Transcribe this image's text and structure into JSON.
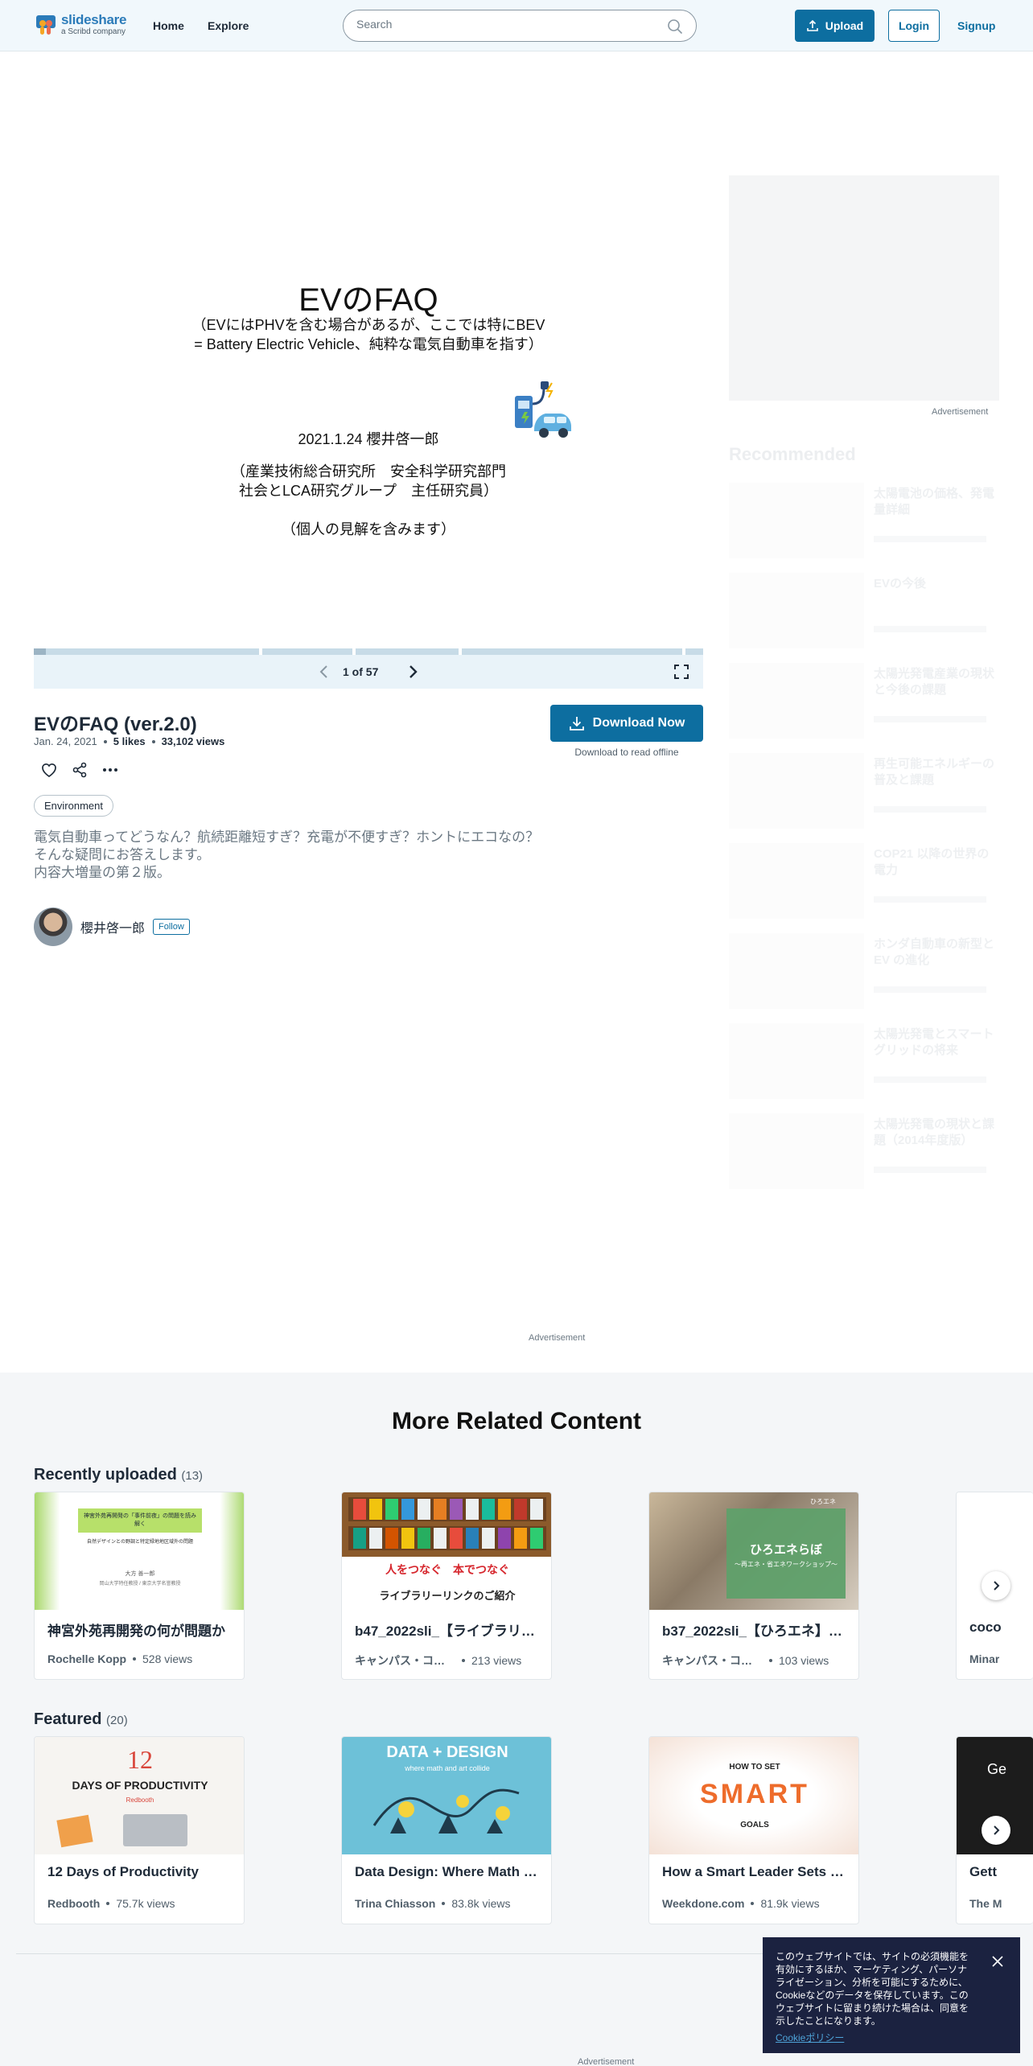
{
  "header": {
    "logo_name": "slideshare",
    "logo_sub": "a Scribd company",
    "nav": [
      "Home",
      "Explore"
    ],
    "search_placeholder": "Search",
    "upload_label": "Upload",
    "login_label": "Login",
    "signup_label": "Signup"
  },
  "slide": {
    "title": "EVのFAQ",
    "subtitle_1": "（EVにはPHVを含む場合があるが、ここでは特にBEV",
    "subtitle_2": "= Battery Electric Vehicle、純粋な電気自動車を指す）",
    "date_author": "2021.1.24 櫻井啓一郎",
    "org_1": "（産業技術総合研究所　安全科学研究部門",
    "org_2": "社会とLCA研究グループ　主任研究員）",
    "note": "（個人の見解を含みます）",
    "page_count": "1 of 57",
    "progress": 0.0175
  },
  "document": {
    "title": "EVのFAQ (ver.2.0)",
    "date": "Jan. 24, 2021",
    "likes": "5 likes",
    "views": "33,102 views",
    "tag": "Environment",
    "description": "電気自動車ってどうなん？航続距離短すぎ？充電が不便すぎ？ホントにエコなの？\nそんな疑問にお答えします。\n内容大増量の第２版。",
    "author": "櫻井啓一郎",
    "follow_label": "Follow",
    "download_label": "Download Now",
    "download_note": "Download to read offline"
  },
  "ads": {
    "label": "Advertisement"
  },
  "recommended": {
    "title": "Recommended",
    "items": [
      {
        "title": "太陽電池の価格、発電量詳細"
      },
      {
        "title": "EVの今後"
      },
      {
        "title": "太陽光発電産業の現状と今後の課題"
      },
      {
        "title": "再生可能エネルギーの普及と課題"
      },
      {
        "title": "COP21 以降の世界の電力"
      },
      {
        "title": "ホンダ自動車の新型と EV の進化"
      },
      {
        "title": "太陽光発電とスマートグリッドの将来"
      },
      {
        "title": "太陽光発電の現状と課題（2014年度版）"
      }
    ]
  },
  "related": {
    "title": "More Related Content",
    "recent": {
      "label": "Recently uploaded",
      "count": "(13)",
      "cards": [
        {
          "title": "神宮外苑再開発の何が問題か",
          "author": "Rochelle Kopp",
          "views": "528 views"
        },
        {
          "title": "b47_2022sli_【ライブラリーリンクのご紹介】",
          "author": "キャンパス・コンソーシアム函館",
          "views": "213 views"
        },
        {
          "title": "b37_2022sli_【ひろエネ】ワークショップ",
          "author": "キャンパス・コンソーシアム函館",
          "views": "103 views"
        },
        {
          "title": "coco",
          "author": "Minar",
          "views": ""
        }
      ]
    },
    "featured": {
      "label": "Featured",
      "count": "(20)",
      "cards": [
        {
          "title": "12 Days of Productivity",
          "author": "Redbooth",
          "views": "75.7k views"
        },
        {
          "title": "Data Design: Where Math and Art Collide",
          "author": "Trina Chiasson",
          "views": "83.8k views"
        },
        {
          "title": "How a Smart Leader Sets Goals",
          "author": "Weekdone.com",
          "views": "81.9k views"
        },
        {
          "title": "Gett",
          "author": "The M",
          "views": ""
        }
      ]
    },
    "thumbs": {
      "r1_line1": "神宮外苑再開発の「事件前夜」の問題を読み解く",
      "r1_line2": "自然デザインとの野調と特定緑地地区域外の問題",
      "r1_line3": "大方 善一郎",
      "r1_line4": "岡山大学特任教授 / 東京大学名誉教授",
      "r2_line1": "人をつなぐ　本でつなぐ",
      "r2_line2": "ライブラリーリンクのご紹介",
      "r3_line1": "ひろエネらぼ",
      "r3_line2": "～再エネ・省エネワークショップ～",
      "r3_tag": "ひろエネ",
      "f1_num": "12",
      "f1_text": "DAYS OF PRODUCTIVITY",
      "f1_brand": "Redbooth",
      "f2_text": "DATA + DESIGN",
      "f2_sub": "where math and art collide",
      "f3_top": "HOW TO SET",
      "f3_main": "SMART",
      "f3_bottom": "GOALS",
      "f4_text": "Ge"
    }
  },
  "cookie": {
    "text": "このウェブサイトでは、サイトの必須機能を有効にするほか、マーケティング、パーソナライゼーション、分析を可能にするために、Cookieなどのデータを保存しています。このウェブサイトに留まり続けた場合は、同意を示したことになります。",
    "link": "Cookieポリシー"
  },
  "colors": {
    "brand": "#0d6ea0",
    "header_bg": "#f1f8fc",
    "cookie_bg": "#1b2240"
  }
}
